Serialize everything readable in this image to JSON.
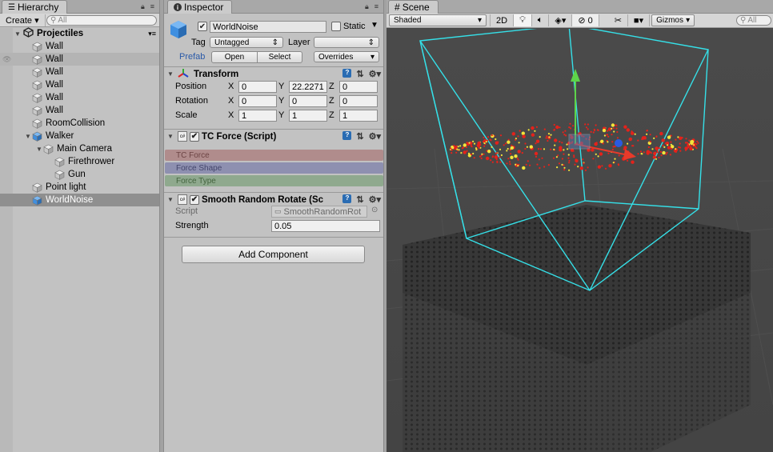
{
  "hierarchy": {
    "tab_label": "Hierarchy",
    "create_label": "Create ▾",
    "search_placeholder": "All",
    "scene_name": "Projectiles",
    "rows": [
      {
        "label": "Wall",
        "indent": 1,
        "state": ""
      },
      {
        "label": "Wall",
        "indent": 1,
        "state": "hov"
      },
      {
        "label": "Wall",
        "indent": 1,
        "state": ""
      },
      {
        "label": "Wall",
        "indent": 1,
        "state": ""
      },
      {
        "label": "Wall",
        "indent": 1,
        "state": ""
      },
      {
        "label": "Wall",
        "indent": 1,
        "state": ""
      },
      {
        "label": "RoomCollision",
        "indent": 1,
        "state": ""
      },
      {
        "label": "Walker",
        "indent": 1,
        "state": ""
      },
      {
        "label": "Main Camera",
        "indent": 2,
        "state": ""
      },
      {
        "label": "Firethrower",
        "indent": 3,
        "state": ""
      },
      {
        "label": "Gun",
        "indent": 3,
        "state": ""
      },
      {
        "label": "Point light",
        "indent": 1,
        "state": ""
      },
      {
        "label": "WorldNoise",
        "indent": 1,
        "state": "sel"
      }
    ]
  },
  "inspector": {
    "tab_label": "Inspector",
    "object_name": "WorldNoise",
    "static_label": "Static",
    "tag_label": "Tag",
    "tag_value": "Untagged",
    "layer_label": "Layer",
    "layer_value": "",
    "prefab_label": "Prefab",
    "open_label": "Open",
    "select_label": "Select",
    "overrides_label": "Overrides",
    "transform": {
      "title": "Transform",
      "position_label": "Position",
      "rotation_label": "Rotation",
      "scale_label": "Scale",
      "x": "X",
      "y": "Y",
      "z": "Z",
      "position": [
        "0",
        "22.2271",
        "0"
      ],
      "rotation": [
        "0",
        "0",
        "0"
      ],
      "scale": [
        "1",
        "1",
        "1"
      ]
    },
    "tc_force": {
      "title": "TC Force (Script)",
      "bars": [
        "TC Force",
        "Force Shape",
        "Force Type"
      ]
    },
    "smooth_rotate": {
      "title": "Smooth Random Rotate (Sc",
      "script_label": "Script",
      "script_value": "SmoothRandomRot",
      "strength_label": "Strength",
      "strength_value": "0.05"
    },
    "add_component_label": "Add Component"
  },
  "scene": {
    "tab_label": "Scene",
    "shading_mode": "Shaded",
    "mode_2d": "2D",
    "hidden_count": "0",
    "gizmos_label": "Gizmos",
    "search_placeholder": "All"
  },
  "colors": {
    "panel_bg": "#c2c2c2",
    "scene_bg": "#474747",
    "bounds_cyan": "#35e0e8",
    "selection": "#8f8f8f"
  }
}
